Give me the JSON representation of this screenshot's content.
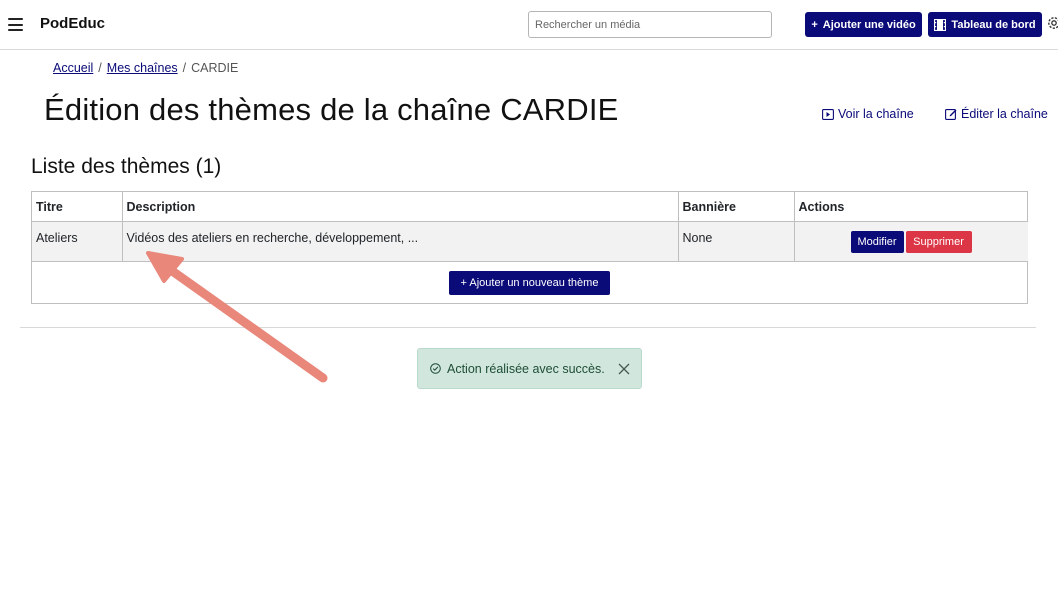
{
  "app": {
    "brand": "PodEduc"
  },
  "header": {
    "search_placeholder": "Rechercher un média",
    "add_video_label": "Ajouter une vidéo",
    "dashboard_label": "Tableau de bord"
  },
  "breadcrumb": {
    "items": [
      "Accueil",
      "Mes chaînes",
      "CARDIE"
    ],
    "separator": "/"
  },
  "page": {
    "title": "Édition des thèmes de la chaîne CARDIE",
    "view_channel_label": "Voir la chaîne",
    "edit_channel_label": "Éditer la chaîne"
  },
  "themes": {
    "list_title": "Liste des thèmes (1)",
    "columns": [
      "Titre",
      "Description",
      "Bannière",
      "Actions"
    ],
    "rows": [
      {
        "titre": "Ateliers",
        "description": "Vidéos des ateliers en recherche, développement, ...",
        "banniere": "None"
      }
    ],
    "modify_label": "Modifier",
    "delete_label": "Supprimer",
    "add_theme_label": "+ Ajouter un nouveau thème"
  },
  "alert": {
    "message": "Action réalisée avec succès.",
    "status": "success"
  },
  "colors": {
    "primary": "#0a0a78",
    "danger": "#dc3545",
    "success_bg": "#d1e7dd",
    "annotation_arrow": "#e8877a"
  }
}
